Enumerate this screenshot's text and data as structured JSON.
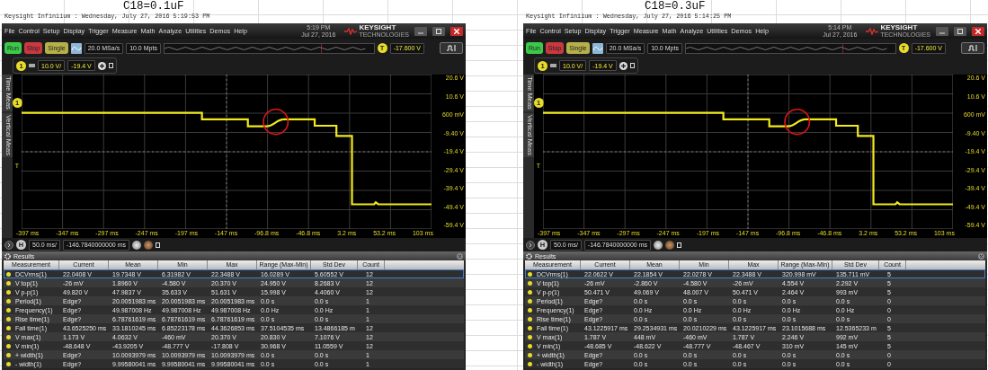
{
  "panels": [
    {
      "caption": "C18=0.1uF",
      "header": "Keysight Infiniium : Wednesday, July 27, 2016 5:19:53 PM",
      "menu": [
        "File",
        "Control",
        "Setup",
        "Display",
        "Trigger",
        "Measure",
        "Math",
        "Analyze",
        "Utilities",
        "Demos",
        "Help"
      ],
      "clock_time": "5:19 PM",
      "clock_date": "Jul 27, 2016",
      "brand": "KEYSIGHT",
      "brand_sub": "TECHNOLOGIES",
      "acq_buttons": [
        {
          "label": "Run",
          "kind": "run"
        },
        {
          "label": "Stop",
          "kind": "stop"
        },
        {
          "label": "Single",
          "kind": "single"
        }
      ],
      "sample_rate": "20.0 MSa/s",
      "memory": "10.0 Mpts",
      "trigger_badge": "T",
      "trigger_level": "-17.600 V",
      "channel_badge": "1",
      "vscale": "10.0 V/",
      "voffset": "-19.4 V",
      "side_tabs": [
        "Time Meas",
        "Vertical Meas"
      ],
      "y_labels": [
        "20.6 V",
        "10.6 V",
        "600 mV",
        "-9.40 V",
        "-19.4 V",
        "-29.4 V",
        "-39.4 V",
        "-49.4 V",
        "-59.4 V"
      ],
      "x_labels": [
        "-397 ms",
        "-347 ms",
        "-297 ms",
        "-247 ms",
        "-197 ms",
        "-147 ms",
        "-96.8 ms",
        "-46.8 ms",
        "3.2 ms",
        "53.2 ms",
        "103 ms"
      ],
      "trace_channel": "1",
      "trigger_marker": "T",
      "h_badge": "H",
      "hscale": "50.0 ms/",
      "hoffset": "-146.7840000000 ms",
      "results_title": "Results",
      "columns": [
        "Measurement",
        "Current",
        "Mean",
        "Min",
        "Max",
        "Range (Max-Min)",
        "Std Dev",
        "Count"
      ],
      "rows": [
        {
          "selected": true,
          "cells": [
            "DCVrms(1)",
            "22.0408 V",
            "19.7348 V",
            "6.31982 V",
            "22.3488 V",
            "16.0289 V",
            "5.60552 V",
            "12"
          ]
        },
        {
          "selected": false,
          "cells": [
            "V top(1)",
            "-26 mV",
            "1.8960 V",
            "-4.580 V",
            "20.370 V",
            "24.950 V",
            "8.2683 V",
            "12"
          ]
        },
        {
          "selected": false,
          "cells": [
            "V p-p(1)",
            "49.820 V",
            "47.9837 V",
            "35.633 V",
            "51.631 V",
            "15.998 V",
            "4.4060 V",
            "12"
          ]
        },
        {
          "selected": false,
          "cells": [
            "Period(1)",
            "Edge?",
            "20.0051983 ms",
            "20.0051983 ms",
            "20.0051983 ms",
            "0.0 s",
            "0.0 s",
            "1"
          ]
        },
        {
          "selected": false,
          "cells": [
            "Frequency(1)",
            "Edge?",
            "49.987008 Hz",
            "49.987008 Hz",
            "49.987008 Hz",
            "0.0 Hz",
            "0.0 Hz",
            "1"
          ]
        },
        {
          "selected": false,
          "cells": [
            "Rise time(1)",
            "Edge?",
            "6.78761619 ms",
            "6.78761619 ms",
            "6.78761619 ms",
            "0.0 s",
            "0.0 s",
            "1"
          ]
        },
        {
          "selected": false,
          "cells": [
            "Fall time(1)",
            "43.6525250 ms",
            "33.1810245 ms",
            "6.85223178 ms",
            "44.3626853 ms",
            "37.5104535 ms",
            "13.4866185 m",
            "12"
          ]
        },
        {
          "selected": false,
          "cells": [
            "V max(1)",
            "1.173 V",
            "4.0632 V",
            "-460 mV",
            "20.370 V",
            "20.830 V",
            "7.1076 V",
            "12"
          ]
        },
        {
          "selected": false,
          "cells": [
            "V min(1)",
            "-48.648 V",
            "-43.9205 V",
            "-48.777 V",
            "-17.808 V",
            "30.968 V",
            "11.0559 V",
            "12"
          ]
        },
        {
          "selected": false,
          "cells": [
            "+ width(1)",
            "Edge?",
            "10.0093979 ms",
            "10.0093979 ms",
            "10.0093979 ms",
            "0.0 s",
            "0.0 s",
            "1"
          ]
        },
        {
          "selected": false,
          "cells": [
            "- width(1)",
            "Edge?",
            "9.99580041 ms",
            "9.99580041 ms",
            "9.99580041 ms",
            "0.0 s",
            "0.0 s",
            "1"
          ]
        }
      ]
    },
    {
      "caption": "C18=0.3uF",
      "header": "Keysight Infiniium : Wednesday, July 27, 2016 5:14:25 PM",
      "menu": [
        "File",
        "Control",
        "Setup",
        "Display",
        "Trigger",
        "Measure",
        "Math",
        "Analyze",
        "Utilities",
        "Demos",
        "Help"
      ],
      "clock_time": "5:14 PM",
      "clock_date": "Jul 27, 2016",
      "brand": "KEYSIGHT",
      "brand_sub": "TECHNOLOGIES",
      "acq_buttons": [
        {
          "label": "Run",
          "kind": "run"
        },
        {
          "label": "Stop",
          "kind": "stop"
        },
        {
          "label": "Single",
          "kind": "single"
        }
      ],
      "sample_rate": "20.0 MSa/s",
      "memory": "10.0 Mpts",
      "trigger_badge": "T",
      "trigger_level": "-17.600 V",
      "channel_badge": "1",
      "vscale": "10.0 V/",
      "voffset": "-19.4 V",
      "side_tabs": [
        "Time Meas",
        "Vertical Meas"
      ],
      "y_labels": [
        "20.6 V",
        "10.6 V",
        "600 mV",
        "-9.40 V",
        "-19.4 V",
        "-29.4 V",
        "-39.4 V",
        "-49.4 V",
        "-59.4 V"
      ],
      "x_labels": [
        "-397 ms",
        "-347 ms",
        "-297 ms",
        "-247 ms",
        "-197 ms",
        "-147 ms",
        "-96.8 ms",
        "-46.8 ms",
        "3.2 ms",
        "53.2 ms",
        "103 ms"
      ],
      "trace_channel": "1",
      "trigger_marker": "T",
      "h_badge": "H",
      "hscale": "50.0 ms/",
      "hoffset": "-146.7840000000 ms",
      "results_title": "Results",
      "columns": [
        "Measurement",
        "Current",
        "Mean",
        "Min",
        "Max",
        "Range (Max-Min)",
        "Std Dev",
        "Count"
      ],
      "rows": [
        {
          "selected": true,
          "cells": [
            "DCVrms(1)",
            "22.0622 V",
            "22.1854 V",
            "22.0278 V",
            "22.3488 V",
            "320.998 mV",
            "135.711 mV",
            "5"
          ]
        },
        {
          "selected": false,
          "cells": [
            "V top(1)",
            "-26 mV",
            "-2.860 V",
            "-4.580 V",
            "-26 mV",
            "4.554 V",
            "2.292 V",
            "5"
          ]
        },
        {
          "selected": false,
          "cells": [
            "V p-p(1)",
            "50.471 V",
            "49.069 V",
            "48.007 V",
            "50.471 V",
            "2.464 V",
            "993 mV",
            "5"
          ]
        },
        {
          "selected": false,
          "cells": [
            "Period(1)",
            "Edge?",
            "0.0 s",
            "0.0 s",
            "0.0 s",
            "0.0 s",
            "0.0 s",
            "0"
          ]
        },
        {
          "selected": false,
          "cells": [
            "Frequency(1)",
            "Edge?",
            "0.0 Hz",
            "0.0 Hz",
            "0.0 Hz",
            "0.0 Hz",
            "0.0 Hz",
            "0"
          ]
        },
        {
          "selected": false,
          "cells": [
            "Rise time(1)",
            "Edge?",
            "0.0 s",
            "0.0 s",
            "0.0 s",
            "0.0 s",
            "0.0 s",
            "0"
          ]
        },
        {
          "selected": false,
          "cells": [
            "Fall time(1)",
            "43.1225917 ms",
            "29.2534931 ms",
            "20.0210229 ms",
            "43.1225917 ms",
            "23.1015688 ms",
            "12.5365233 m",
            "5"
          ]
        },
        {
          "selected": false,
          "cells": [
            "V max(1)",
            "1.787 V",
            "448 mV",
            "-460 mV",
            "1.787 V",
            "2.246 V",
            "992 mV",
            "5"
          ]
        },
        {
          "selected": false,
          "cells": [
            "V min(1)",
            "-48.685 V",
            "-48.622 V",
            "-48.777 V",
            "-48.467 V",
            "310 mV",
            "145 mV",
            "5"
          ]
        },
        {
          "selected": false,
          "cells": [
            "+ width(1)",
            "Edge?",
            "0.0 s",
            "0.0 s",
            "0.0 s",
            "0.0 s",
            "0.0 s",
            "0"
          ]
        },
        {
          "selected": false,
          "cells": [
            "- width(1)",
            "Edge?",
            "0.0 s",
            "0.0 s",
            "0.0 s",
            "0.0 s",
            "0.0 s",
            "0"
          ]
        }
      ]
    }
  ]
}
